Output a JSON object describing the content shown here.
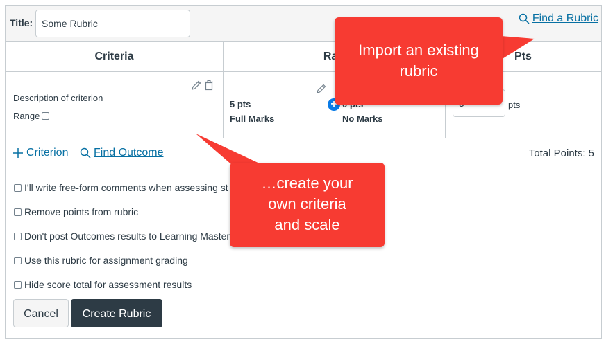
{
  "header": {
    "title_label": "Title:",
    "title_value": "Some Rubric",
    "find_rubric": "Find a Rubric"
  },
  "table": {
    "headers": [
      "Criteria",
      "Rati",
      "Pts"
    ],
    "criterion": {
      "description": "Description of criterion",
      "range_label": "Range"
    },
    "ratings": [
      {
        "pts": "5 pts",
        "label": "Full Marks"
      },
      {
        "pts": "0 pts",
        "label": "No Marks"
      }
    ],
    "points_value": "5",
    "points_unit": "pts"
  },
  "footer": {
    "add_criterion": "Criterion",
    "find_outcome": "Find Outcome",
    "total_points": "Total Points: 5"
  },
  "options": [
    "I'll write free-form comments when assessing st",
    "Remove points from rubric",
    "Don't post Outcomes results to Learning Master",
    "Use this rubric for assignment grading",
    "Hide score total for assessment results"
  ],
  "buttons": {
    "cancel": "Cancel",
    "create": "Create Rubric"
  },
  "callouts": {
    "import_line1": "Import an existing",
    "import_line2": "rubric",
    "create_line1": "…create your",
    "create_line2": "own criteria",
    "create_line3": "and scale"
  },
  "colors": {
    "link": "#0770a3",
    "callout": "#f73b32",
    "primary_button": "#2d3b45",
    "add_rating": "#0a7be6"
  }
}
